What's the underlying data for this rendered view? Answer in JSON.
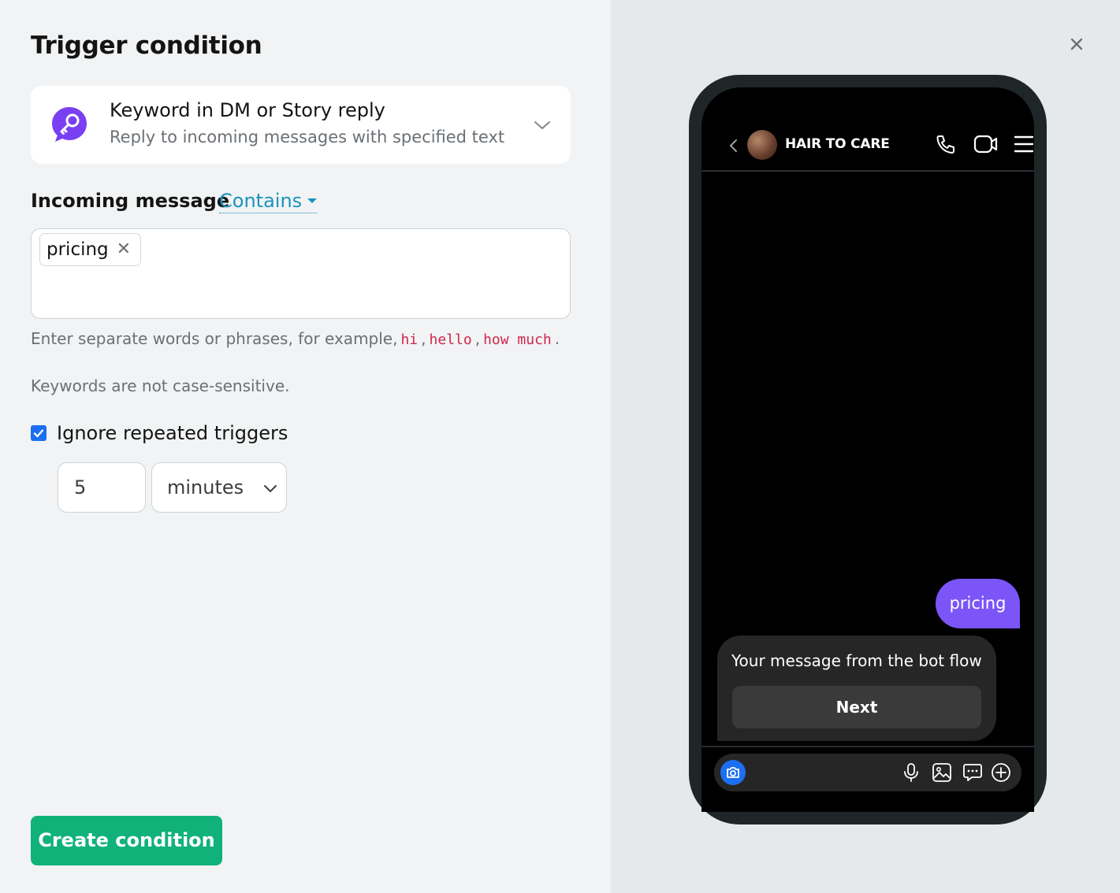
{
  "panel": {
    "title": "Trigger condition",
    "trigger": {
      "title": "Keyword in DM or Story reply",
      "subtitle": "Reply to incoming messages with specified text",
      "icon": "key-chat-icon"
    },
    "incoming_label": "Incoming message",
    "match_mode": "Contains",
    "keywords": [
      "pricing"
    ],
    "hint": {
      "prefix": "Enter separate words or phrases, for example,",
      "examples": [
        "hi",
        "hello",
        "how much"
      ],
      "suffix": ".",
      "note": "Keywords are not case-sensitive."
    },
    "ignore_repeated": {
      "label": "Ignore repeated triggers",
      "checked": true,
      "value": "5",
      "unit": "minutes"
    },
    "create_button": "Create condition",
    "close_icon": "close-icon"
  },
  "preview": {
    "account_name": "HAIR TO CARE",
    "outgoing_message": "pricing",
    "bot_message": "Your message from the bot flow",
    "bot_button": "Next",
    "colors": {
      "outgoing_bubble": "#7b55f7",
      "incoming_bubble": "#262626",
      "camera_button": "#1d6ff2"
    }
  },
  "colors": {
    "accent_link": "#1a94bd",
    "primary_button": "#10b27a",
    "checkbox": "#1a6ff0",
    "code_text": "#d0264e"
  }
}
